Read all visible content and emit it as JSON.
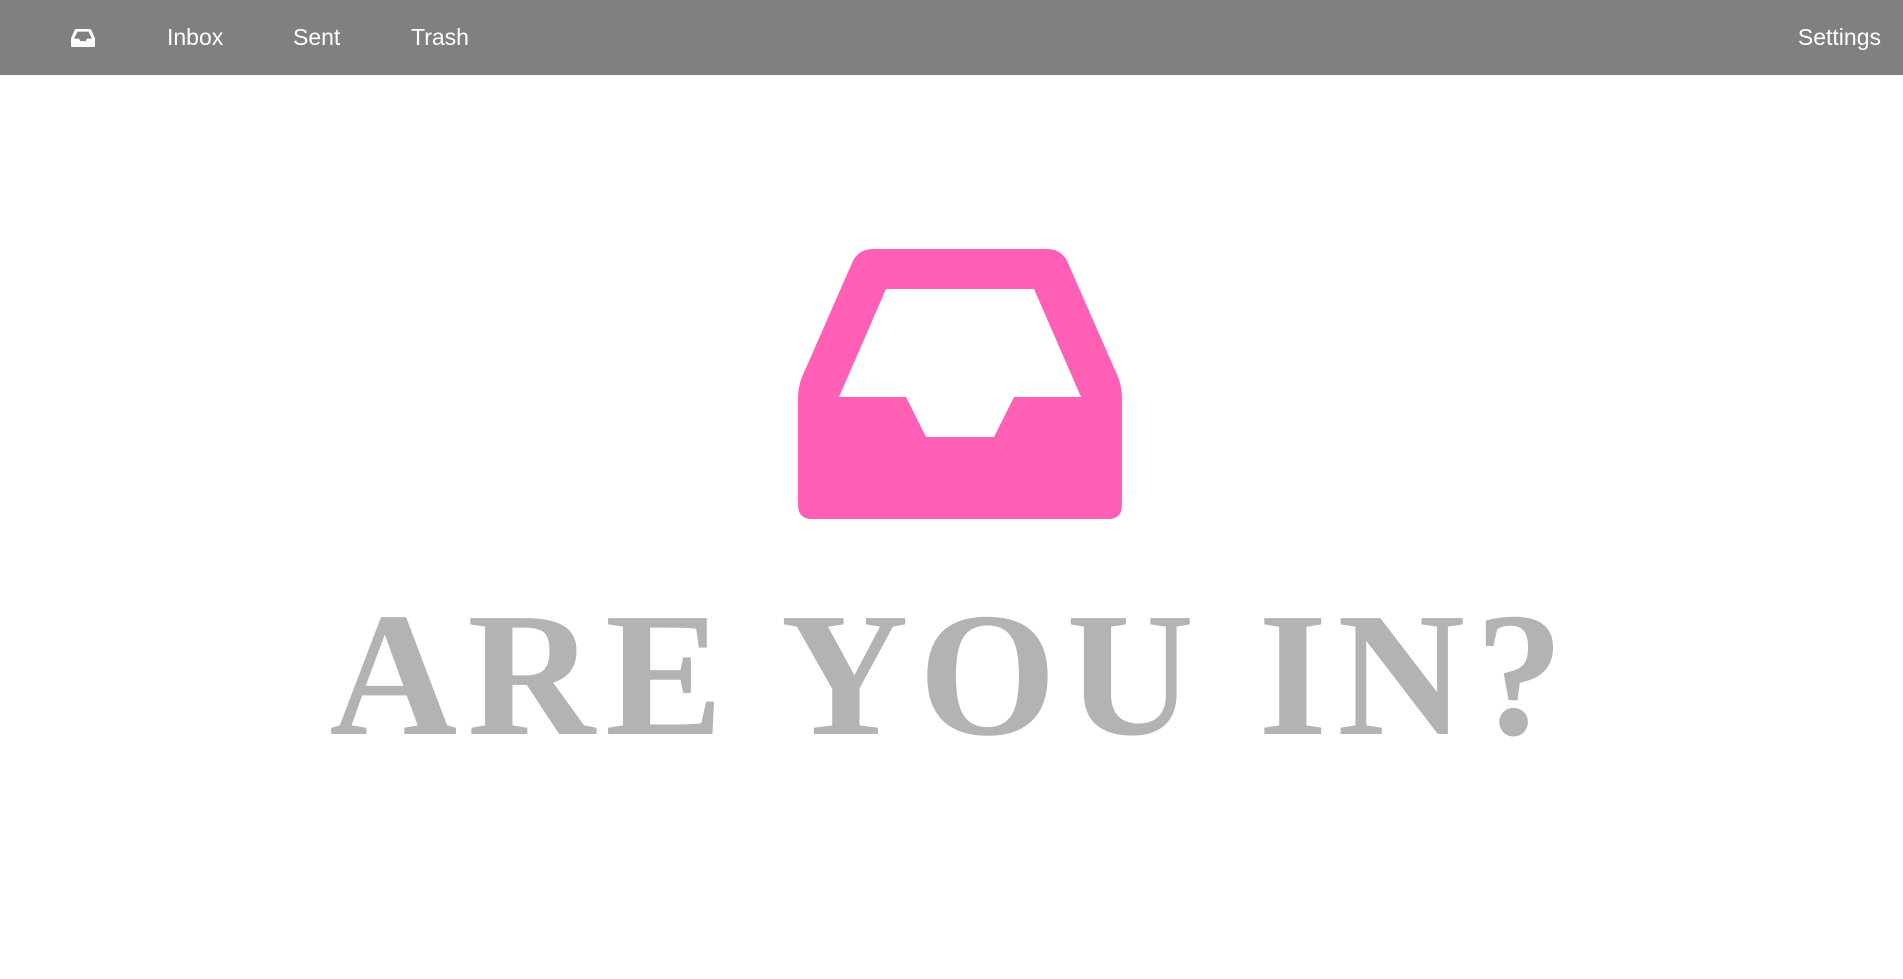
{
  "navbar": {
    "logo_icon": "inbox-tray-icon",
    "links": {
      "inbox": "Inbox",
      "sent": "Sent",
      "trash": "Trash",
      "settings": "Settings"
    }
  },
  "hero": {
    "icon": "inbox-tray-icon",
    "icon_color": "#ff5fb4",
    "title": "ARE YOU IN?"
  },
  "colors": {
    "navbar_bg": "#808080",
    "nav_text": "#ffffff",
    "title_text": "#b3b3b3"
  }
}
